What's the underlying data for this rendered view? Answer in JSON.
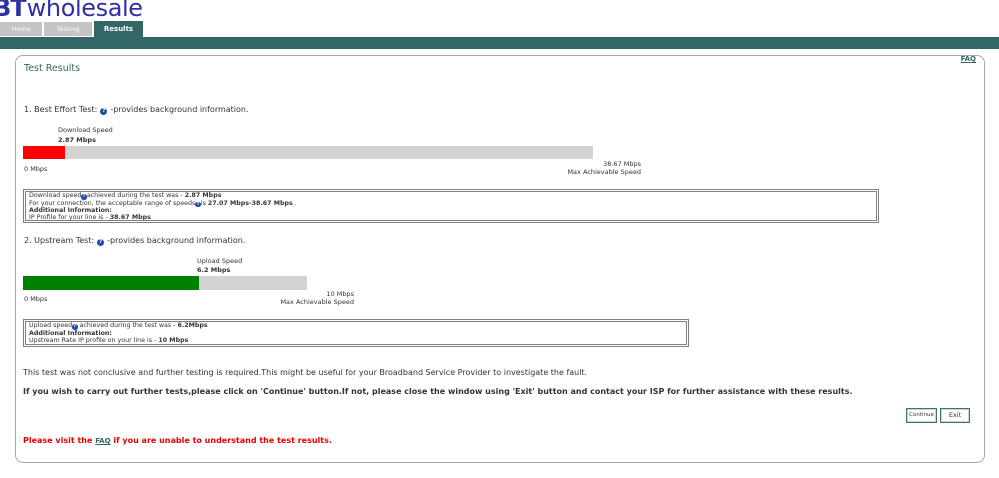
{
  "brand": {
    "logo_mark": "BT",
    "logo_word": "wholesale"
  },
  "tabs": [
    {
      "label": "Home",
      "active": false
    },
    {
      "label": "Testing",
      "active": false
    },
    {
      "label": "Results",
      "active": true
    }
  ],
  "faq_link": "FAQ",
  "page_title": "Test Results",
  "download_test": {
    "heading": "1. Best Effort Test:",
    "heading_note": "-provides background information.",
    "info_icon": "help-icon",
    "meter": {
      "label": "Download Speed",
      "value_text": "2.87 Mbps",
      "measured_mbps": 2.87,
      "max_mbps": 38.67,
      "min_label": "0 Mbps",
      "max_label": "38.67 Mbps",
      "max_caption": "Max Achievable Speed"
    },
    "details": {
      "speed_label": "Download speed",
      "speed_text": "achieved during the test was - ",
      "speed_value": "2.87 Mbps",
      "range_label": "For your connection, the acceptable range of speeds",
      "range_text": "is ",
      "range_value": "27.07 Mbps-38.67 Mbps",
      "range_end": " .",
      "additional_heading": "Additional Information:",
      "profile_text": "IP Profile for your line is - ",
      "profile_value": "38.67 Mbps"
    }
  },
  "upload_test": {
    "heading": "2. Upstream Test:",
    "heading_note": "-provides background information.",
    "info_icon": "help-icon",
    "meter": {
      "label": "Upload Speed",
      "value_text": "6.2 Mbps",
      "measured_mbps": 6.2,
      "max_mbps": 10,
      "min_label": "0 Mbps",
      "max_label": "10 Mbps",
      "max_caption": "Max Achievable Speed"
    },
    "details": {
      "speed_label": "Upload speed",
      "speed_text": " achieved during the test was - ",
      "speed_value": "6.2Mbps",
      "additional_heading": "Additional Information:",
      "profile_text": "Upstream Rate IP profile on your line is - ",
      "profile_value": "10 Mbps"
    }
  },
  "result_message": "This test was not conclusive and further testing is required.This might be useful for your Broadband Service Provider to investigate the fault.",
  "instructions": "If you wish to carry out further tests,please click on 'Continue' button.If not, please close the window using 'Exit' button and contact your ISP for further assistance with these results.",
  "actions": {
    "continue_label": "Continue",
    "exit_label": "Exit"
  },
  "faq_notice": {
    "before": "Please visit the ",
    "link": "FAQ",
    "after": " if you are unable to understand the test results."
  },
  "colors": {
    "brand": "#2e31a6",
    "teal": "#336666",
    "tab_inactive": "#c4c4c4",
    "download_bar": "#ff0000",
    "upload_bar": "#008000",
    "bar_track": "#d3d3d3",
    "alert_text": "#e60000",
    "help_icon": "#1f4fa8",
    "body_text": "#333333"
  }
}
